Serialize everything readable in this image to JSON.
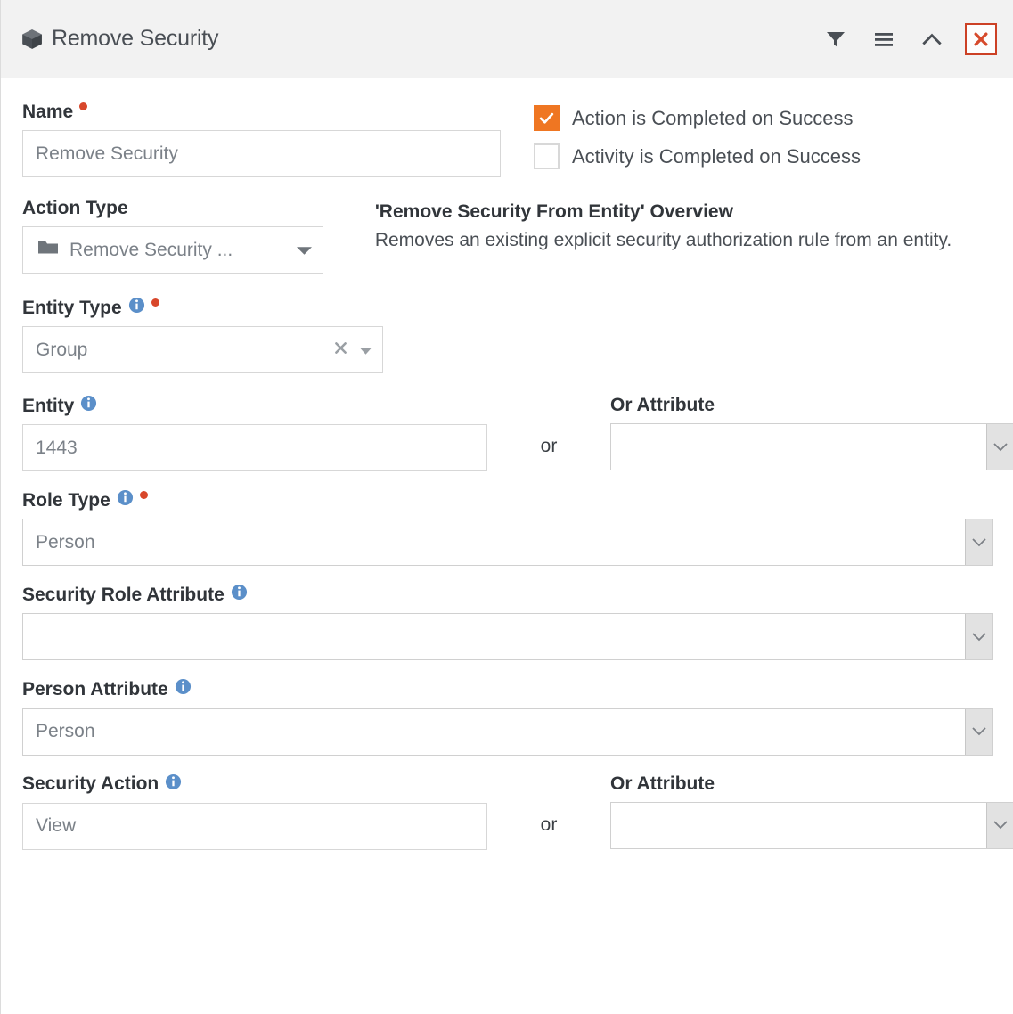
{
  "window": {
    "title": "Remove Security",
    "icon": "cube-icon",
    "toolbar": [
      {
        "name": "filter-icon",
        "label": "Filter"
      },
      {
        "name": "menu-icon",
        "label": "Menu"
      },
      {
        "name": "chevron-up-icon",
        "label": "Collapse"
      },
      {
        "name": "close-icon",
        "label": "Close"
      }
    ],
    "accent_color": "#ef7622",
    "close_color": "#cc4125",
    "required_color": "#d8472b",
    "info_color": "#5b8fc9"
  },
  "form": {
    "name": {
      "label": "Name",
      "required": true,
      "value": "Remove Security",
      "placeholder": "Remove Security"
    },
    "checkboxes": [
      {
        "label": "Action is Completed on Success",
        "checked": true
      },
      {
        "label": "Activity is Completed on Success",
        "checked": false
      }
    ],
    "action_type": {
      "label": "Action Type",
      "value": "Remove Security ...",
      "icon": "folder-icon"
    },
    "overview": {
      "title": "'Remove Security From Entity' Overview",
      "description": "Removes an existing explicit security authorization rule from an entity."
    },
    "entity_type": {
      "label": "Entity Type",
      "required": true,
      "info": true,
      "value": "Group",
      "clear_icon": "close-small-icon",
      "caret_icon": "caret-down-icon"
    },
    "entity": {
      "label": "Entity",
      "info": true,
      "value": "1443",
      "separator": "or"
    },
    "entity_or_attribute": {
      "label": "Or Attribute",
      "value": ""
    },
    "role_type": {
      "label": "Role Type",
      "required": true,
      "info": true,
      "value": "Person"
    },
    "security_role_attribute": {
      "label": "Security Role Attribute",
      "info": true,
      "value": ""
    },
    "person_attribute": {
      "label": "Person Attribute",
      "info": true,
      "value": "Person"
    },
    "security_action": {
      "label": "Security Action",
      "info": true,
      "value": "View",
      "separator": "or"
    },
    "security_action_or_attribute": {
      "label": "Or Attribute",
      "value": ""
    }
  }
}
